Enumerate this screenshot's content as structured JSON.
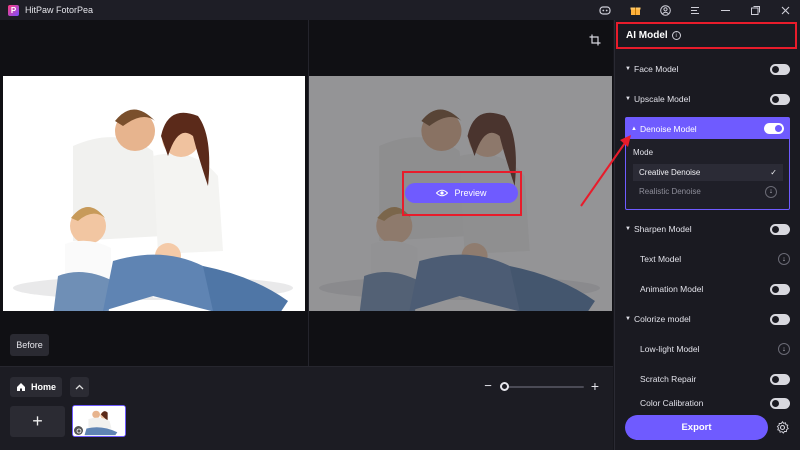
{
  "app": {
    "title": "HitPaw FotorPea",
    "logo_letter": "P"
  },
  "titlebar_icons": [
    "discord-icon",
    "gift-icon",
    "account-icon",
    "menu-icon",
    "minimize-icon",
    "maximize-icon",
    "close-icon"
  ],
  "canvas": {
    "before_label": "Before",
    "preview_label": "Preview"
  },
  "bottom": {
    "home_label": "Home",
    "zoom_minus": "−",
    "zoom_plus": "+",
    "add_label": "+"
  },
  "panel": {
    "title": "AI Model",
    "info": "i",
    "models": [
      {
        "label": "Face Model",
        "control": "toggle",
        "on": false
      },
      {
        "label": "Upscale Model",
        "control": "toggle",
        "on": false
      }
    ],
    "denoise": {
      "label": "Denoise Model",
      "on": true,
      "mode_label": "Mode",
      "options": [
        {
          "label": "Creative Denoise",
          "state": "selected",
          "mark": "✓"
        },
        {
          "label": "Realistic Denoise",
          "state": "download",
          "mark": "↓"
        }
      ]
    },
    "more_models": [
      {
        "label": "Sharpen Model",
        "control": "toggle",
        "caret": true
      },
      {
        "label": "Text Model",
        "control": "download",
        "caret": false
      },
      {
        "label": "Animation Model",
        "control": "toggle",
        "caret": false
      },
      {
        "label": "Colorize model",
        "control": "toggle",
        "caret": true
      },
      {
        "label": "Low-light Model",
        "control": "download",
        "caret": false
      },
      {
        "label": "Scratch Repair",
        "control": "toggle",
        "caret": false
      },
      {
        "label": "Color Calibration",
        "control": "toggle",
        "caret": false
      }
    ],
    "export_label": "Export"
  },
  "colors": {
    "accent": "#6f5bff",
    "highlight": "#e81c2b",
    "panel_bg": "#1a1a21"
  }
}
